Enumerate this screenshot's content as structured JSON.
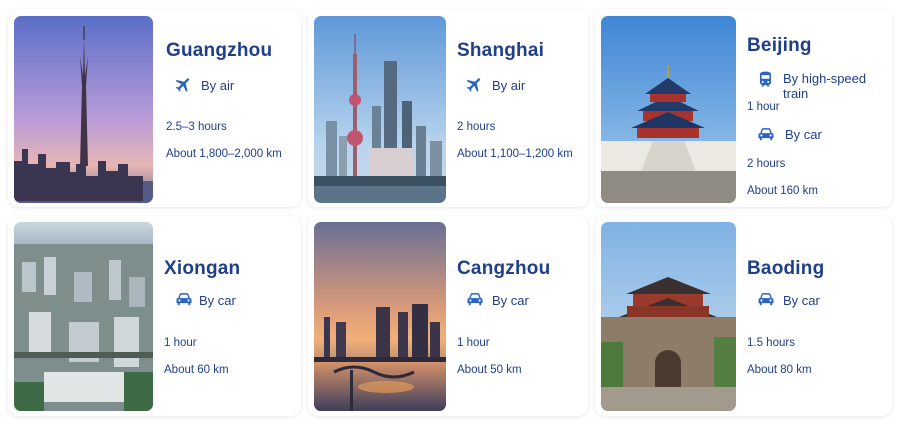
{
  "colors": {
    "accent": "#2a64c4",
    "text": "#1f3f8a"
  },
  "cards": [
    {
      "city": "Guangzhou",
      "image": "canton-tower-skyline",
      "modes": [
        {
          "icon": "plane-icon",
          "label": "By air",
          "duration": "2.5–3 hours"
        }
      ],
      "distance": "About 1,800–2,000 km"
    },
    {
      "city": "Shanghai",
      "image": "oriental-pearl-skyline",
      "modes": [
        {
          "icon": "plane-icon",
          "label": "By air",
          "duration": "2 hours"
        }
      ],
      "distance": "About 1,100–1,200 km"
    },
    {
      "city": "Beijing",
      "image": "temple-of-heaven",
      "modes": [
        {
          "icon": "train-icon",
          "label": "By high-speed train",
          "duration": "1 hour"
        },
        {
          "icon": "car-icon",
          "label": "By car",
          "duration": "2 hours"
        }
      ],
      "distance": "About 160 km"
    },
    {
      "city": "Xiongan",
      "image": "new-city-aerial",
      "modes": [
        {
          "icon": "car-icon",
          "label": "By car",
          "duration": "1 hour"
        }
      ],
      "distance": "About 60 km"
    },
    {
      "city": "Cangzhou",
      "image": "river-sunset-skyline",
      "modes": [
        {
          "icon": "car-icon",
          "label": "By car",
          "duration": "1 hour"
        }
      ],
      "distance": "About 50 km"
    },
    {
      "city": "Baoding",
      "image": "ancient-city-gate",
      "modes": [
        {
          "icon": "car-icon",
          "label": "By car",
          "duration": "1.5 hours"
        }
      ],
      "distance": "About 80 km"
    }
  ]
}
